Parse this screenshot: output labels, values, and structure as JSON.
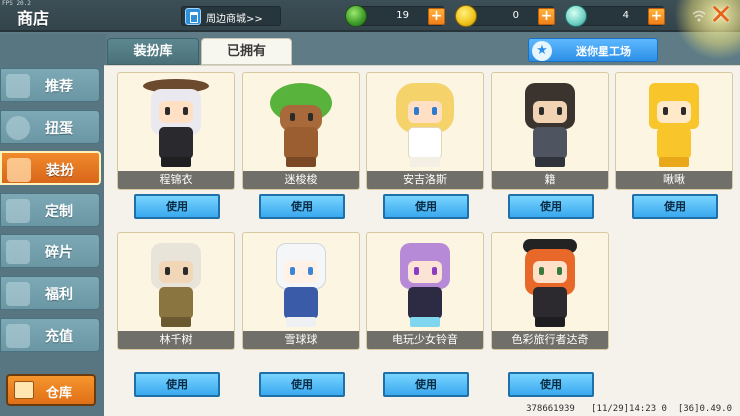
{
  "fps": "FPS 20.2",
  "header": {
    "title": "商店",
    "merch_label": "周边商城>>",
    "currencies": [
      {
        "name": "gem-currency",
        "value": "19"
      },
      {
        "name": "coin-currency",
        "value": "0"
      },
      {
        "name": "silver-currency",
        "value": "4"
      }
    ],
    "plus": "+",
    "close": "✕"
  },
  "sidebar": {
    "items": [
      {
        "label": "推荐",
        "icon": "thumb-icon"
      },
      {
        "label": "扭蛋",
        "icon": "capsule-icon"
      },
      {
        "label": "装扮",
        "icon": "shirt-icon"
      },
      {
        "label": "定制",
        "icon": "brush-icon"
      },
      {
        "label": "碎片",
        "icon": "puzzle-icon"
      },
      {
        "label": "福利",
        "icon": "gift-icon"
      },
      {
        "label": "充值",
        "icon": "wallet-icon"
      }
    ],
    "active_index": 2,
    "warehouse": "仓库"
  },
  "tabs": {
    "costume": "装扮库",
    "owned": "已拥有",
    "active": "owned"
  },
  "workshop": {
    "label": "迷你星工场",
    "icon": "star-icon"
  },
  "use_label": "使用",
  "skins": [
    {
      "name": "程锦衣"
    },
    {
      "name": "迷梭梭"
    },
    {
      "name": "安吉洛斯"
    },
    {
      "name": "籍"
    },
    {
      "name": "啾啾"
    },
    {
      "name": "林千树"
    },
    {
      "name": "雪球球"
    },
    {
      "name": "电玩少女铃音"
    },
    {
      "name": "色彩旅行者达奇"
    }
  ],
  "status": {
    "uid": "378661939",
    "time": "[11/29]14:23 0",
    "ver": "[36]0.49.0"
  },
  "colors": {
    "accent_orange": "#e87a1e",
    "button_blue": "#39a9ee",
    "panel_bg": "#f4f2ea"
  }
}
